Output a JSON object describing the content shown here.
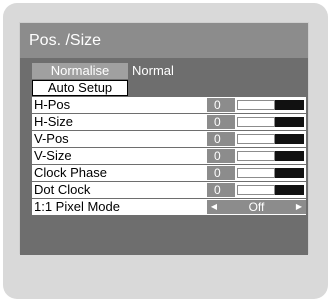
{
  "menu": {
    "title": "Pos. /Size",
    "normalise_label": "Normalise",
    "normalise_status": "Normal",
    "auto_setup_label": "Auto Setup",
    "rows": [
      {
        "label": "H-Pos",
        "value": "0",
        "level": 0.5
      },
      {
        "label": "H-Size",
        "value": "0",
        "level": 0.5
      },
      {
        "label": "V-Pos",
        "value": "0",
        "level": 0.5
      },
      {
        "label": "V-Size",
        "value": "0",
        "level": 0.5
      },
      {
        "label": "Clock Phase",
        "value": "0",
        "level": 0.5
      },
      {
        "label": "Dot Clock",
        "value": "0",
        "level": 0.5
      }
    ],
    "pixel_mode": {
      "label": "1:1 Pixel Mode",
      "value": "Off",
      "left_arrow_icon": "triangle-left-icon",
      "right_arrow_icon": "triangle-right-icon"
    }
  },
  "colors": {
    "title_bar": "#8c8c8c",
    "panel_body": "#6e6e6e",
    "outer_background": "#d9d9d9",
    "slider_dark": "#111111"
  }
}
